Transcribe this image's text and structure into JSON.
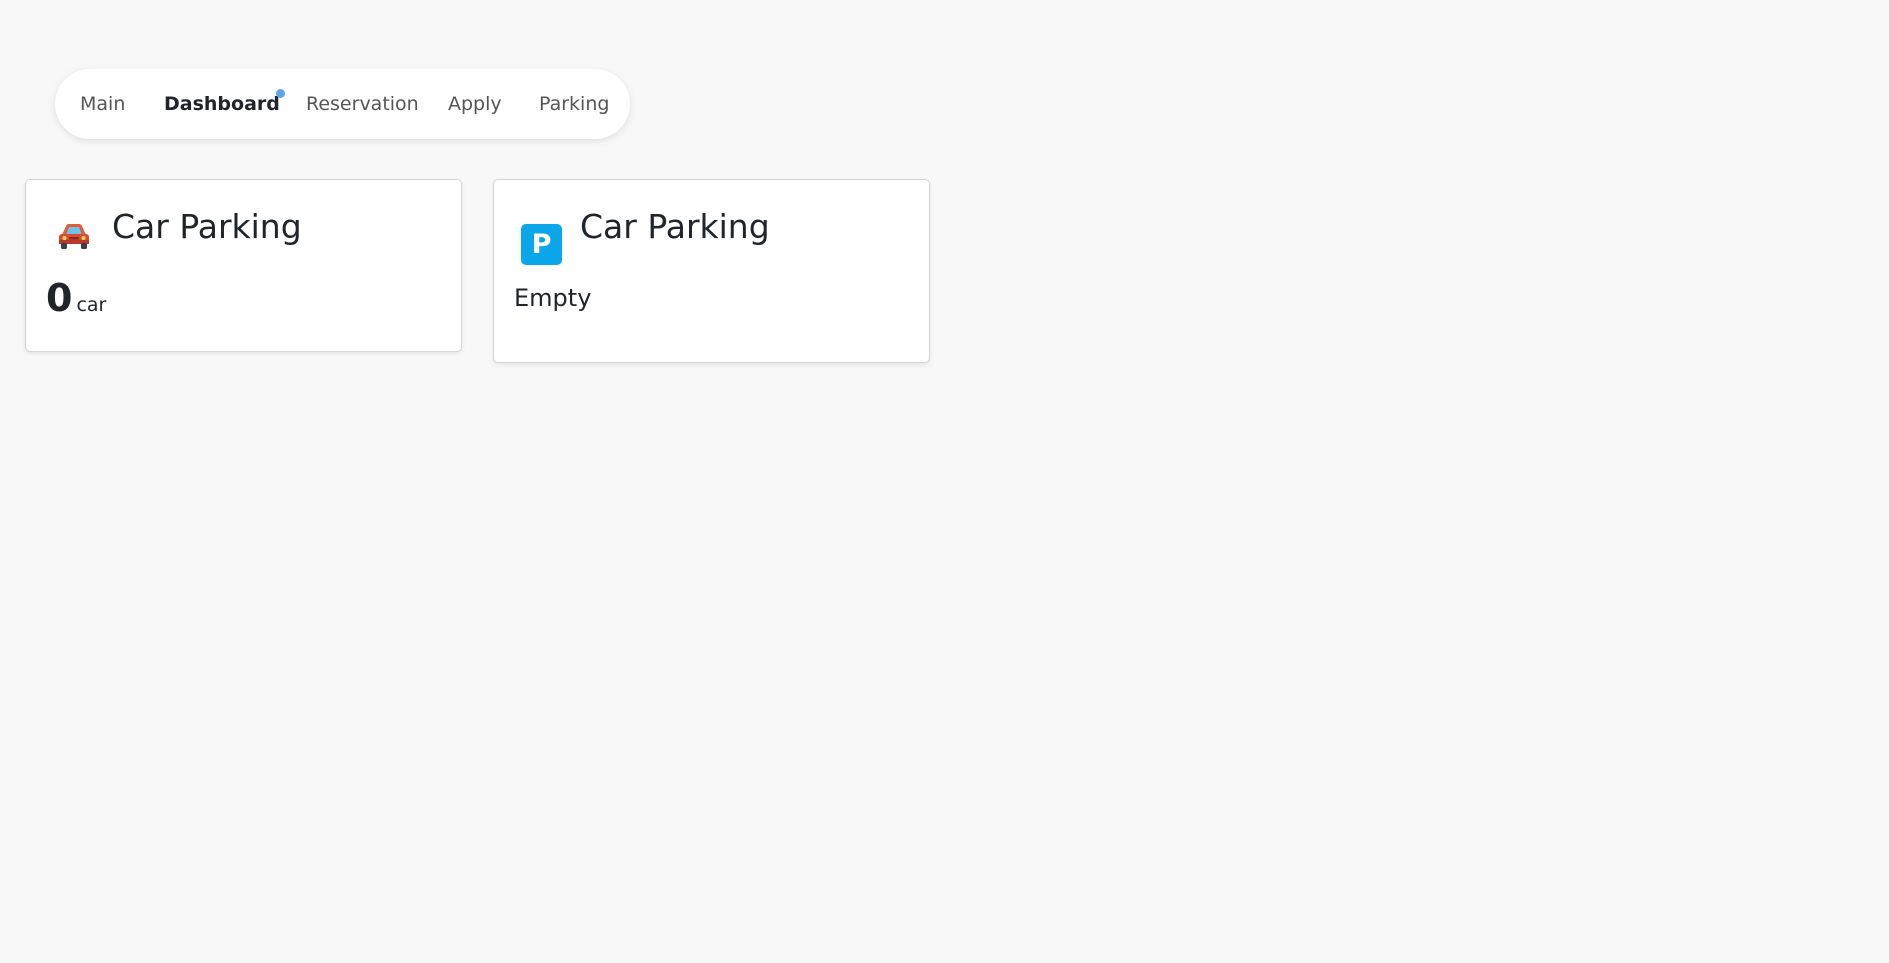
{
  "nav": {
    "items": [
      {
        "label": "Main",
        "active": false
      },
      {
        "label": "Dashboard",
        "active": true
      },
      {
        "label": "Reservation",
        "active": false
      },
      {
        "label": "Apply",
        "active": false
      },
      {
        "label": "Parking",
        "active": false
      }
    ],
    "indicator_color": "#5aa8ea"
  },
  "cards": [
    {
      "title": "Car Parking",
      "icon": "car-icon",
      "count": "0",
      "unit": "car"
    },
    {
      "title": "Car Parking",
      "icon": "parking-sign-icon",
      "icon_text": "P",
      "icon_color": "#0ba5e9",
      "status": "Empty"
    }
  ]
}
